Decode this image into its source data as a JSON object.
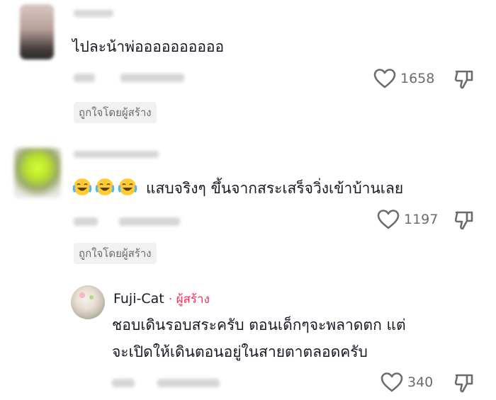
{
  "comments": [
    {
      "text": "ไปละน้าพ่ออออออออออ",
      "likes": "1658",
      "liked_by_creator": "ถูกใจโดยผู้สร้าง"
    },
    {
      "text": "แสบจริงๆ ขึ้นจากสระเสร็จวิ่งเข้าบ้านเลย",
      "emoji_icons": [
        "face-with-tears-of-joy-icon",
        "face-with-tears-of-joy-icon",
        "face-with-tears-of-joy-icon"
      ],
      "likes": "1197",
      "liked_by_creator": "ถูกใจโดยผู้สร้าง"
    }
  ],
  "reply": {
    "username": "Fuji-Cat",
    "creator_label": "· ผู้สร้าง",
    "text_line1": "ชอบเดินรอบสระครับ ตอนเด็กๆจะพลาดตก แต่",
    "text_line2": "จะเปิดให้เดินตอนอยู่ในสายตาตลอดครับ",
    "likes": "340"
  },
  "colors": {
    "text": "#161823",
    "muted": "#6b6b70",
    "creator_accent": "#fe2c55",
    "badge_bg": "#f1f1f2"
  }
}
